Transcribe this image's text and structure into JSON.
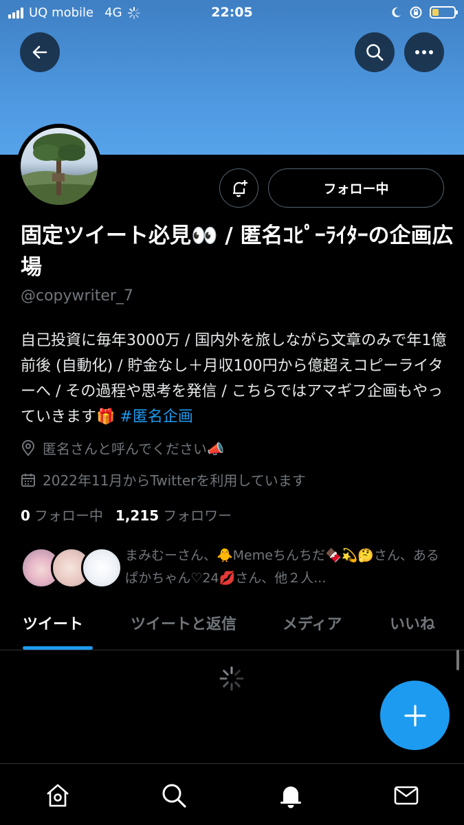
{
  "status_bar": {
    "carrier": "UQ mobile",
    "network": "4G",
    "time": "22:05",
    "icons": [
      "signal-icon",
      "loading-icon",
      "moon-icon",
      "rotation-lock-icon",
      "battery-icon"
    ],
    "battery_color": "#f7d154"
  },
  "header": {
    "banner_color": "#4d97df",
    "buttons": [
      "back-arrow-icon",
      "search-icon",
      "more-icon"
    ]
  },
  "profile": {
    "name": "固定ツイート必見👀 / 匿名ｺﾋﾟｰﾗｲﾀｰの企画広場",
    "handle": "@copywriter_7",
    "bio": "自己投資に毎年3000万 / 国内外を旅しながら文章のみで年1億前後 (自動化) / 貯金なし＋月収100円から億超えコピーライターへ / その過程や思考を発信 / こちらではアマギフ企画もやっていきます🎁 ",
    "bio_hashtag": "#匿名企画",
    "location": "匿名さんと呼んでください📣",
    "joined": "2022年11月からTwitterを利用しています",
    "following_count": "0",
    "following_label": "フォロー中",
    "followers_count": "1,215",
    "followers_label": "フォロワー",
    "followed_by_text": "まみむーさん、🐥Memeちんちだ🍫💫🤔さん、あるぱかちゃん♡24💋さん、他２人..."
  },
  "actions": {
    "follow_button": "フォロー中",
    "notify_icon": "bell-plus-icon"
  },
  "tabs": [
    {
      "label": "ツイート",
      "active": true
    },
    {
      "label": "ツイートと返信",
      "active": false
    },
    {
      "label": "メディア",
      "active": false
    },
    {
      "label": "いいね",
      "active": false
    }
  ],
  "accent_color": "#1d9bf0",
  "bottom_nav": [
    "home-icon",
    "search-icon",
    "notifications-icon",
    "messages-icon"
  ]
}
